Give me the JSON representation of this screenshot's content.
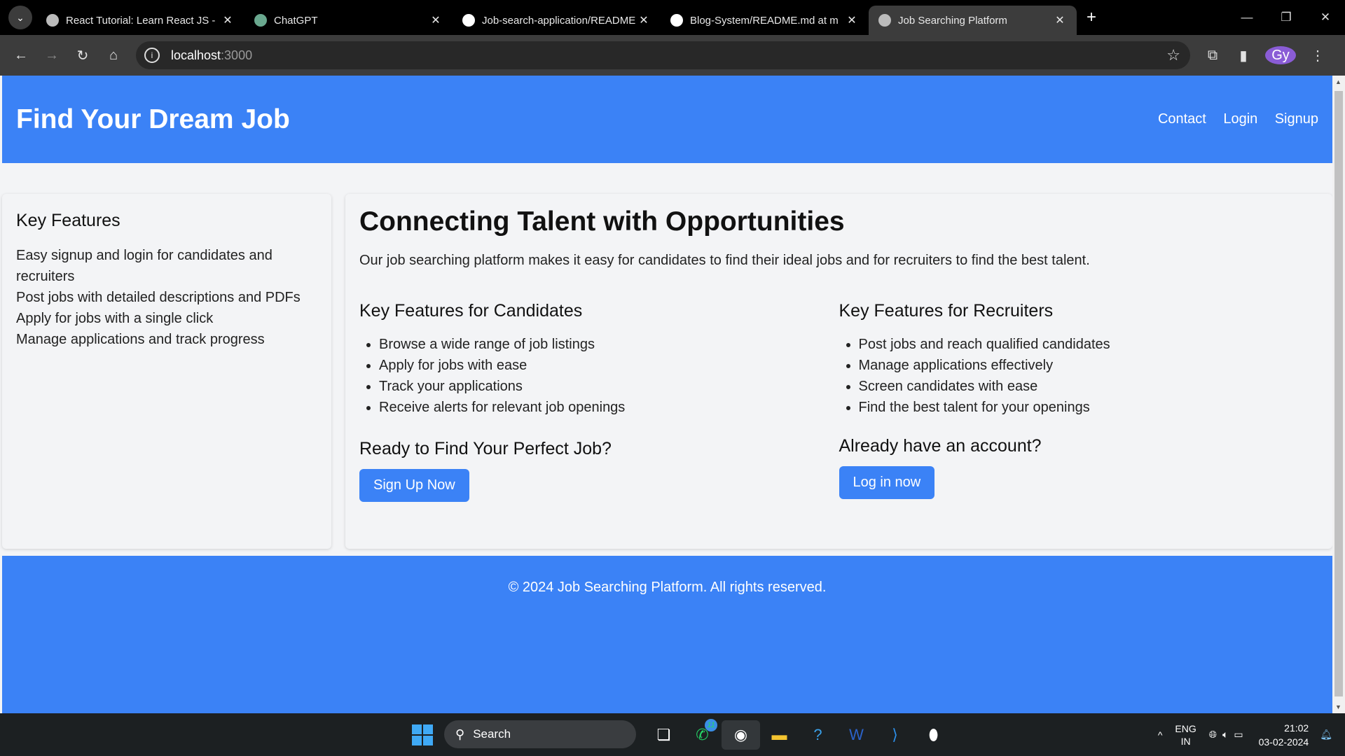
{
  "browser": {
    "tabs": [
      {
        "title": "React Tutorial: Learn React JS -",
        "active": false
      },
      {
        "title": "ChatGPT",
        "active": false
      },
      {
        "title": "Job-search-application/README",
        "active": false
      },
      {
        "title": "Blog-System/README.md at m",
        "active": false
      },
      {
        "title": "Job Searching Platform",
        "active": true
      }
    ],
    "url_host": "localhost",
    "url_port": ":3000",
    "profile": "Gy"
  },
  "header": {
    "title": "Find Your Dream Job",
    "nav": [
      "Contact",
      "Login",
      "Signup"
    ]
  },
  "sidebar": {
    "title": "Key Features",
    "items": [
      "Easy signup and login for candidates and recruiters",
      "Post jobs with detailed descriptions and PDFs",
      "Apply for jobs with a single click",
      "Manage applications and track progress"
    ]
  },
  "main": {
    "title": "Connecting Talent with Opportunities",
    "lead": "Our job searching platform makes it easy for candidates to find their ideal jobs and for recruiters to find the best talent.",
    "candidates": {
      "title": "Key Features for Candidates",
      "items": [
        "Browse a wide range of job listings",
        "Apply for jobs with ease",
        "Track your applications",
        "Receive alerts for relevant job openings"
      ],
      "cta_title": "Ready to Find Your Perfect Job?",
      "cta_button": "Sign Up Now"
    },
    "recruiters": {
      "title": "Key Features for Recruiters",
      "items": [
        "Post jobs and reach qualified candidates",
        "Manage applications effectively",
        "Screen candidates with ease",
        "Find the best talent for your openings"
      ],
      "cta_title": "Already have an account?",
      "cta_button": "Log in now"
    }
  },
  "footer": {
    "text": "© 2024 Job Searching Platform. All rights reserved."
  },
  "taskbar": {
    "search": "Search",
    "whatsapp_badge": "11",
    "lang1": "ENG",
    "lang2": "IN",
    "time": "21:02",
    "date": "03-02-2024"
  },
  "colors": {
    "brand": "#3b82f6",
    "page_bg": "#f3f4f6"
  }
}
